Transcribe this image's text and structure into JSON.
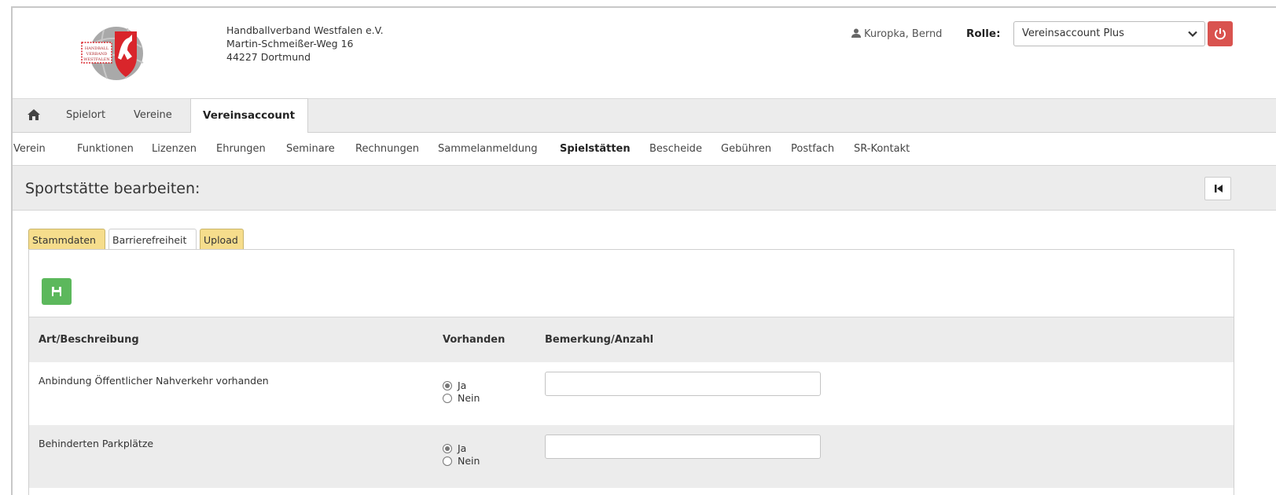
{
  "org": {
    "name": "Handballverband Westfalen e.V.",
    "street": "Martin-Schmeißer-Weg 16",
    "city": "44227 Dortmund"
  },
  "logo_text": [
    "HANDBALL",
    "VERBAND",
    "WESTFALEN"
  ],
  "user": {
    "name": "Kuropka, Bernd",
    "icon": "person-icon"
  },
  "role": {
    "label": "Rolle:",
    "selected": "Vereinsaccount Plus"
  },
  "topnav": {
    "home_icon": "home-icon",
    "items": [
      "Spielort",
      "Vereine"
    ],
    "active": "Vereinsaccount"
  },
  "subnav": {
    "items": [
      "Verein",
      "Funktionen",
      "Lizenzen",
      "Ehrungen",
      "Seminare",
      "Rechnungen",
      "Sammelanmeldung",
      "Spielstätten",
      "Bescheide",
      "Gebühren",
      "Postfach",
      "SR-Kontakt"
    ],
    "current": "Spielstätten"
  },
  "page_title": "Sportstätte bearbeiten:",
  "tabs": [
    "Stammdaten",
    "Barrierefreiheit",
    "Upload"
  ],
  "active_tab": "Barrierefreiheit",
  "table": {
    "headers": {
      "desc": "Art/Beschreibung",
      "present": "Vorhanden",
      "remark": "Bemerkung/Anzahl"
    },
    "rows": [
      {
        "desc": "Anbindung Öffentlicher Nahverkehr vorhanden",
        "yes": "Ja",
        "no": "Nein",
        "selected": "Ja",
        "remark": ""
      },
      {
        "desc": "Behinderten Parkplätze",
        "yes": "Ja",
        "no": "Nein",
        "selected": "Ja",
        "remark": ""
      }
    ]
  },
  "colors": {
    "accent_red": "#d9534f",
    "save_green": "#5cb85c",
    "tab_yellow": "#f6dd8c"
  }
}
